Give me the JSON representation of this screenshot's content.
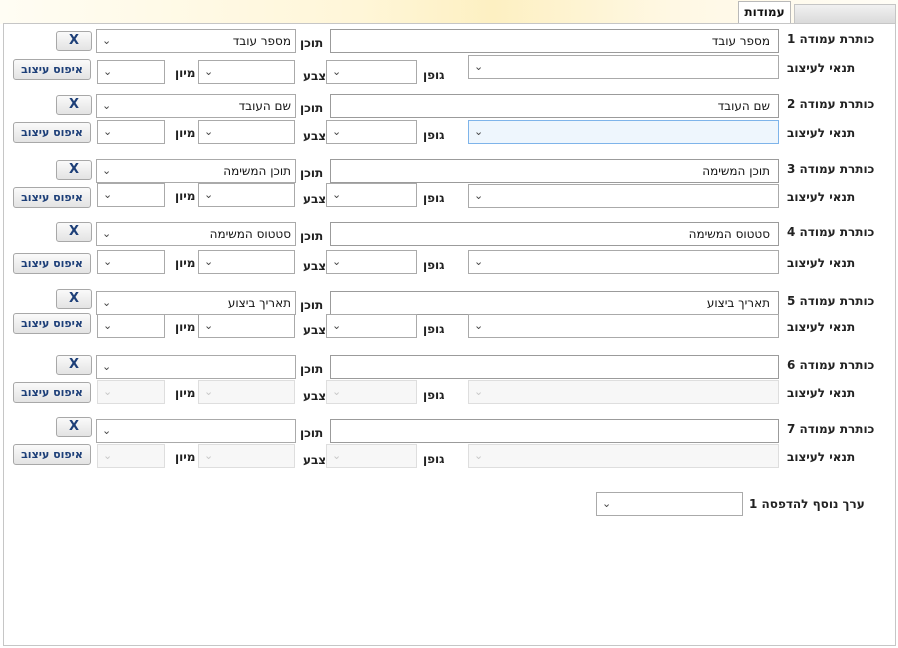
{
  "tabs": [
    {
      "label": "עמודות",
      "active": true
    },
    {
      "label": "",
      "active": false
    }
  ],
  "labels": {
    "header": "כותרת עמודה",
    "content": "תוכן",
    "condition": "תנאי לעיצוב",
    "font": "גופן",
    "color": "צבע",
    "sort": "מיון"
  },
  "buttons": {
    "remove": "X",
    "reset": "איפוס עיצוב"
  },
  "columns": [
    {
      "num": "1",
      "title": "מספר עובד",
      "content": "מספר עובד"
    },
    {
      "num": "2",
      "title": "שם העובד",
      "content": "שם העובד"
    },
    {
      "num": "3",
      "title": "תוכן המשימה",
      "content": "תוכן המשימה"
    },
    {
      "num": "4",
      "title": "סטטוס המשימה",
      "content": "סטטוס המשימה"
    },
    {
      "num": "5",
      "title": "תאריך ביצוע",
      "content": "תאריך ביצוע"
    },
    {
      "num": "6",
      "title": "",
      "content": ""
    },
    {
      "num": "7",
      "title": "",
      "content": ""
    }
  ],
  "extra_print": {
    "label": "ערך נוסף להדפסה 1",
    "value": ""
  },
  "icons": {
    "dropdown": "chevron-down-icon"
  },
  "colors": {
    "button_text": "#1d3f78",
    "focus_border": "#7eb4ea"
  }
}
